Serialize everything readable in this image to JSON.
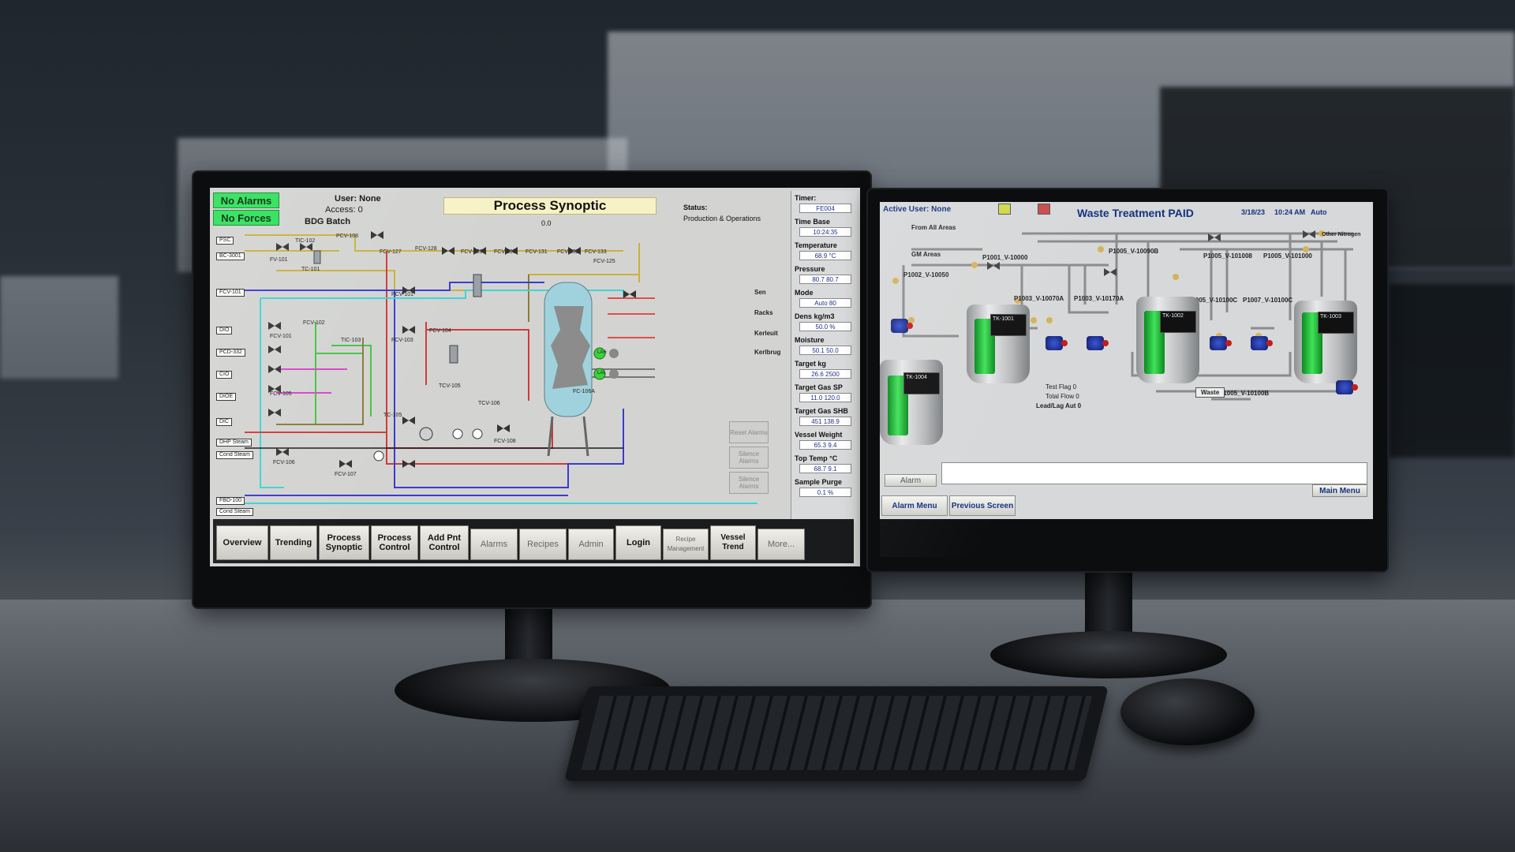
{
  "left_hmi": {
    "badges": {
      "no_alarms": "No Alarms",
      "no_forces": "No Forces"
    },
    "user": "User: None",
    "access": "Access: 0",
    "batch": "BDG Batch",
    "title": "Process Synoptic",
    "status_label": "Status:",
    "status_value": "Production & Operations",
    "zero_readout": "0.0",
    "tags": [
      "PCV-108",
      "FCV-127",
      "FCV-128",
      "FCV-129",
      "FCV-130",
      "FCV-131",
      "FCV-132",
      "FCV-133",
      "TIC-102",
      "FV-101",
      "TC-101",
      "PCV-101",
      "FCV-101",
      "FCV-102",
      "TIC-103",
      "FCV-103",
      "FCV-104",
      "TCV-105",
      "TC-105",
      "FCV-105",
      "FCV-106",
      "FCV-107",
      "FCV-108",
      "TCV-106",
      "FCV-125",
      "FC-106A"
    ],
    "left_inputs": [
      "PSC",
      "BC-3001",
      "FCV-101",
      "DIO",
      "PCD-332",
      "CIO",
      "DIOE",
      "DIC",
      "DHP Steam",
      "Cond Steam",
      "FBD-100",
      "Cond Steam"
    ],
    "right_labels": [
      "Sen",
      "Racks",
      "Kerleuit",
      "Kerlbrug"
    ],
    "vessel_badges": [
      "LAH",
      "LAL"
    ],
    "ack_buttons": [
      "Reset Alarms",
      "Silence Alarms",
      "Silence Alarms"
    ],
    "panel": {
      "items": [
        {
          "label": "Timer:",
          "value": "FE004"
        },
        {
          "label": "Time Base",
          "value": "10:24:35"
        },
        {
          "label": "Temperature",
          "value": "68.9 °C"
        },
        {
          "label": "Pressure",
          "value": "80.7  80.7"
        },
        {
          "label": "Mode",
          "value": "Auto  80"
        },
        {
          "label": "Dens kg/m3",
          "value": "50.0 %"
        },
        {
          "label": "Moisture",
          "value": "50.1  50.0"
        },
        {
          "label": "Target kg",
          "value": "26.6  2500"
        },
        {
          "label": "Target Gas SP",
          "value": "11.0  120.0"
        },
        {
          "label": "Target Gas SHB",
          "value": "451  138.9"
        },
        {
          "label": "Vessel Weight",
          "value": "65.3  9.4"
        },
        {
          "label": "Top Temp °C",
          "value": "68.7  9.1"
        },
        {
          "label": "Sample Purge",
          "value": "0.1  %"
        }
      ]
    },
    "nav": [
      {
        "label": "Overview",
        "kind": "raised"
      },
      {
        "label": "Trending",
        "kind": "raised"
      },
      {
        "label": "Process Synoptic",
        "kind": "raised"
      },
      {
        "label": "Process Control",
        "kind": "raised"
      },
      {
        "label": "Add Pnt Control",
        "kind": "raised"
      },
      {
        "label": "Alarms",
        "kind": "flat"
      },
      {
        "label": "Recipes",
        "kind": "flat"
      },
      {
        "label": "Admin",
        "kind": "flat"
      },
      {
        "label": "Login",
        "kind": "raised"
      },
      {
        "label": "Recipe Management",
        "kind": "flat"
      },
      {
        "label": "Vessel Trend",
        "kind": "raised"
      },
      {
        "label": "More...",
        "kind": "flat"
      }
    ]
  },
  "right_hmi": {
    "active_user": "Active User: None",
    "title": "Waste Treatment PAID",
    "date": "3/18/23",
    "time": "10:24 AM",
    "mode": "Auto",
    "nav_labels": [
      "From All Areas",
      "GM Areas",
      "Other Nitrogen"
    ],
    "valve_tags": [
      "P1001_V-10000",
      "P1002_V-10050",
      "P1003_V-10070A",
      "P1003_V-10170A",
      "P1005_V-10090B",
      "P1005_V-101008",
      "P1005_V-101000",
      "P1005_V-10100C",
      "P1007_V-10100C",
      "P1005_V-10100B"
    ],
    "tanks": [
      "TK-1001",
      "TK-1002",
      "TK-1003",
      "TK-1004"
    ],
    "waste_label": "Waste",
    "flags": [
      "Test Flag 0",
      "Total Flow 0",
      "Lead/Lag Aut 0"
    ],
    "alarm_btn": "Alarm",
    "main_menu": "Main Menu",
    "alarm_menu": "Alarm Menu",
    "previous_screen": "Previous Screen"
  }
}
